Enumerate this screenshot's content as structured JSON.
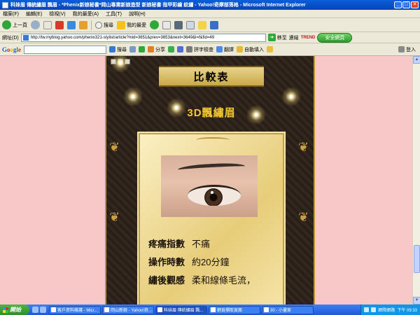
{
  "window": {
    "title": "科妹眉 傳統繡眉 飄眉 - *Phenix新娘秘書*岡山專業新娘造型 新娘秘書 指甲彩繪 紋繡 - Yahoo!奇摩部落格 - Microsoft Internet Explorer"
  },
  "menu": [
    "檔案(F)",
    "編輯(E)",
    "檢視(V)",
    "我的最愛(A)",
    "工具(T)",
    "說明(H)"
  ],
  "toolbar": {
    "back_label": "上一頁",
    "search_label": "搜尋",
    "favorites_label": "我的最愛"
  },
  "address": {
    "label": "網址(D)",
    "url": "http://tw.myblog.yahoo.com/phenix321-stylist/article?mid=3651&prev=3653&next=3649&l=f&fid=49",
    "go_label": "移至",
    "links_label": "連結",
    "trend_label": "TREND",
    "safe_label": "安全網頁"
  },
  "google_bar": {
    "logo": [
      "G",
      "o",
      "o",
      "g",
      "l",
      "e"
    ],
    "search_label": "搜尋",
    "share_label": "分享",
    "spellcheck_label": "拼字檢查",
    "translate_label": "翻譯",
    "autofill_label": "自動填入",
    "signin_label": "登入"
  },
  "article": {
    "heading": "比較表",
    "subheading": "3D飄繡眉",
    "stats": [
      {
        "label": "疼痛指數",
        "value": "不痛"
      },
      {
        "label": "操作時數",
        "value": "約20分鐘"
      },
      {
        "label": "繡後觀感",
        "value": "柔和線條毛流，"
      }
    ]
  },
  "taskbar": {
    "start_label": "開始",
    "tasks": [
      "客戶資料維護 - Micr...",
      "岡山新娘 - Yahoo!奇...",
      "科妹眉 傳統繡眉 飄...",
      "網頁擷取頁面",
      "30 - 小畫家"
    ],
    "tray_label": "網際網路",
    "clock": "下午 09:33"
  },
  "colors": {
    "page_background": "#f8c8c8",
    "titlebar": "#0a5fd8",
    "article_gold": "#f2c838"
  }
}
